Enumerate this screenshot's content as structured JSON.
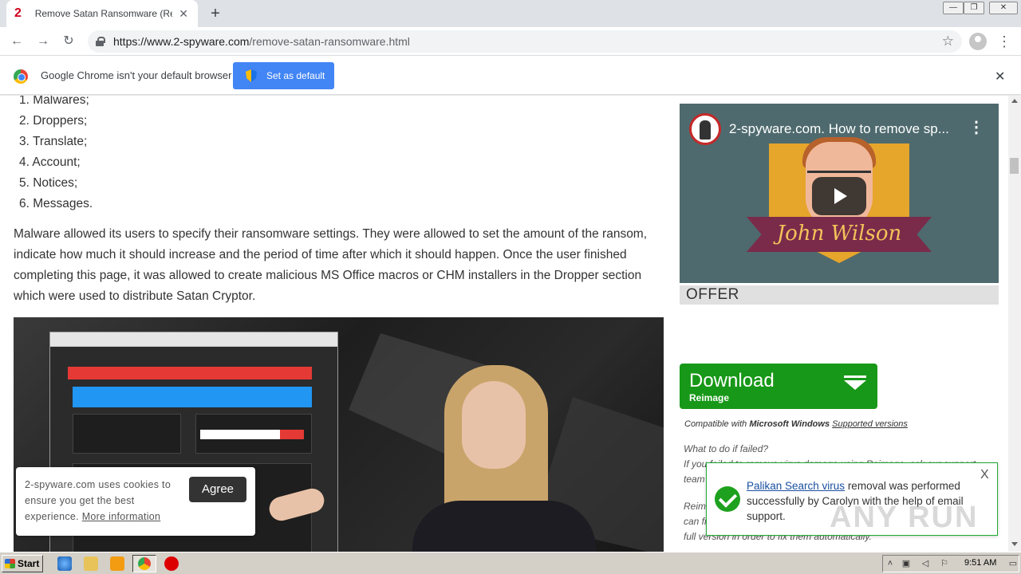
{
  "browser": {
    "tab_title": "Remove Satan Ransomware (Remov",
    "tab_favicon": "2",
    "url_host": "https://www.2-spyware.com",
    "url_path": "/remove-satan-ransomware.html",
    "infobar_text": "Google Chrome isn't your default browser",
    "set_default_label": "Set as default",
    "close_glyph": "✕",
    "newtab_glyph": "+"
  },
  "article": {
    "list_items": [
      "1. Malwares;",
      "2. Droppers;",
      "3. Translate;",
      "4. Account;",
      "5. Notices;",
      "6. Messages."
    ],
    "paragraph": "Malware allowed its users to specify their ransomware settings. They were allowed to set the amount of the ransom, indicate how much it should increase and the period of time after which it should happen. Once the user finished completing this page, it was allowed to create malicious MS Office macros or CHM installers in the Dropper section which were used to distribute Satan Cryptor."
  },
  "cookie_banner": {
    "text": "2-spyware.com uses cookies to ensure you get the best experience.",
    "link": "More information",
    "agree_label": "Agree"
  },
  "sidebar": {
    "video_title": "2-spyware.com. How to remove sp...",
    "video_name_overlay": "John Wilson",
    "offer_label": "OFFER",
    "download_label": "Download",
    "download_sub": "Reimage",
    "compat_prefix": "Compatible with ",
    "compat_os": "Microsoft Windows",
    "compat_link": "Supported versions",
    "fail_heading": "What to do if failed?",
    "fail_text": "If you failed to remove virus damage using Reimage, ask our support team to our",
    "rein_text": "Reimage is recommended to detect malware-caused errors, where you can fix them using free manual repairs or you can decide to purchase the full version in order to fix them automatically."
  },
  "toast": {
    "link": "Palikan Search virus",
    "text": " removal was performed successfully by Carolyn with the help of email support.",
    "close": "X",
    "watermark": "ANY RUN"
  },
  "taskbar": {
    "start_label": "Start",
    "clock": "9:51 AM"
  },
  "colors": {
    "accent_blue": "#4285f4",
    "download_green": "#189818",
    "toast_border": "#1faa32"
  }
}
